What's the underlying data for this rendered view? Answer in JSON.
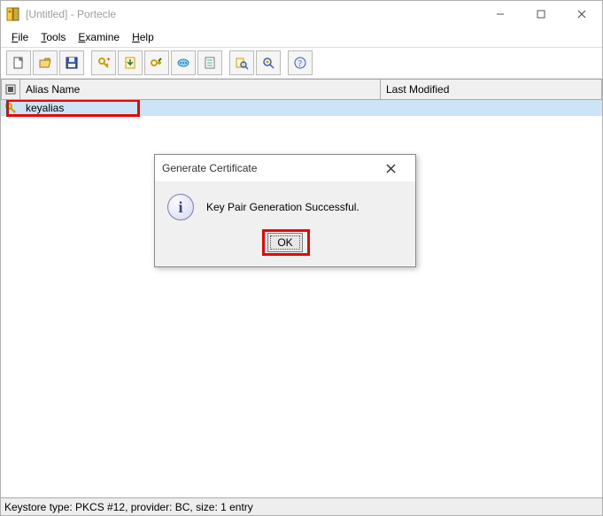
{
  "window": {
    "title": "[Untitled] - Portecle"
  },
  "menu": {
    "file_underline": "F",
    "file_rest": "ile",
    "tools_underline": "T",
    "tools_rest": "ools",
    "examine_underline": "E",
    "examine_rest": "xamine",
    "help_underline": "H",
    "help_rest": "elp"
  },
  "icons": {
    "title_app": "🔑",
    "new": "🗋",
    "open": "📂",
    "save": "💾",
    "genkey": "🔑",
    "import": "📥",
    "setpass": "🔑",
    "report": "💬",
    "rename": "📝",
    "exam": "🔍",
    "examssl": "🔍",
    "help": "?",
    "header_type": "▣",
    "row_key": "🔑"
  },
  "columns": {
    "alias": "Alias Name",
    "modified": "Last Modified"
  },
  "entry": {
    "alias": "keyalias",
    "modified": ""
  },
  "dialog": {
    "title": "Generate Certificate",
    "message": "Key Pair Generation Successful.",
    "info_glyph": "i",
    "ok": "OK"
  },
  "status": "Keystore type: PKCS #12, provider: BC, size: 1 entry"
}
